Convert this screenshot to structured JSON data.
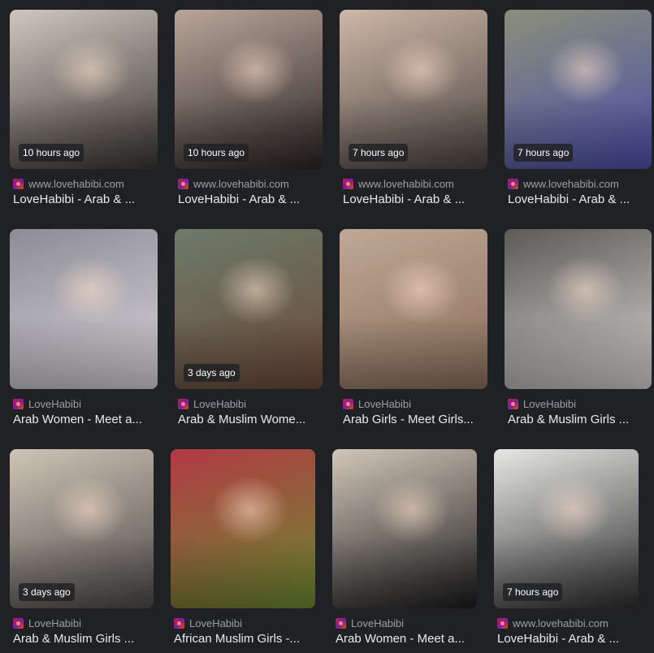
{
  "results": [
    {
      "time": "10 hours ago",
      "source": "www.lovehabibi.com",
      "title": "LoveHabibi - Arab & ...",
      "colors": [
        "#cfc7bf",
        "#3a3532"
      ]
    },
    {
      "time": "10 hours ago",
      "source": "www.lovehabibi.com",
      "title": "LoveHabibi - Arab & ...",
      "colors": [
        "#b9a69b",
        "#2b2424"
      ]
    },
    {
      "time": "7 hours ago",
      "source": "www.lovehabibi.com",
      "title": "LoveHabibi - Arab & ...",
      "colors": [
        "#cdb7a8",
        "#4a4340"
      ]
    },
    {
      "time": "7 hours ago",
      "source": "www.lovehabibi.com",
      "title": "LoveHabibi - Arab & ...",
      "colors": [
        "#8a8f7a",
        "#4b4fa8"
      ]
    },
    {
      "time": "",
      "source": "LoveHabibi",
      "title": "Arab Women - Meet a...",
      "colors": [
        "#8d8c96",
        "#d7d3d8"
      ]
    },
    {
      "time": "3 days ago",
      "source": "LoveHabibi",
      "title": "Arab & Muslim Wome...",
      "colors": [
        "#6d7a6a",
        "#6b4a3a"
      ]
    },
    {
      "time": "",
      "source": "LoveHabibi",
      "title": "Arab Girls - Meet Girls...",
      "colors": [
        "#bfa896",
        "#8a6e5a"
      ]
    },
    {
      "time": "",
      "source": "LoveHabibi",
      "title": "Arab & Muslim Girls ...",
      "colors": [
        "#5c5a57",
        "#d6d3d2"
      ]
    },
    {
      "time": "3 days ago",
      "source": "LoveHabibi",
      "title": "Arab & Muslim Girls ...",
      "colors": [
        "#cfc4b6",
        "#4b4848"
      ]
    },
    {
      "time": "",
      "source": "LoveHabibi",
      "title": "African Muslim Girls -...",
      "colors": [
        "#b33a45",
        "#6a8a2f"
      ]
    },
    {
      "time": "",
      "source": "LoveHabibi",
      "title": "Arab Women - Meet a...",
      "colors": [
        "#d2c6b8",
        "#1b1b1d"
      ]
    },
    {
      "time": "7 hours ago",
      "source": "www.lovehabibi.com",
      "title": "LoveHabibi - Arab & ...",
      "colors": [
        "#e7e7e6",
        "#2c2c2c"
      ]
    }
  ]
}
